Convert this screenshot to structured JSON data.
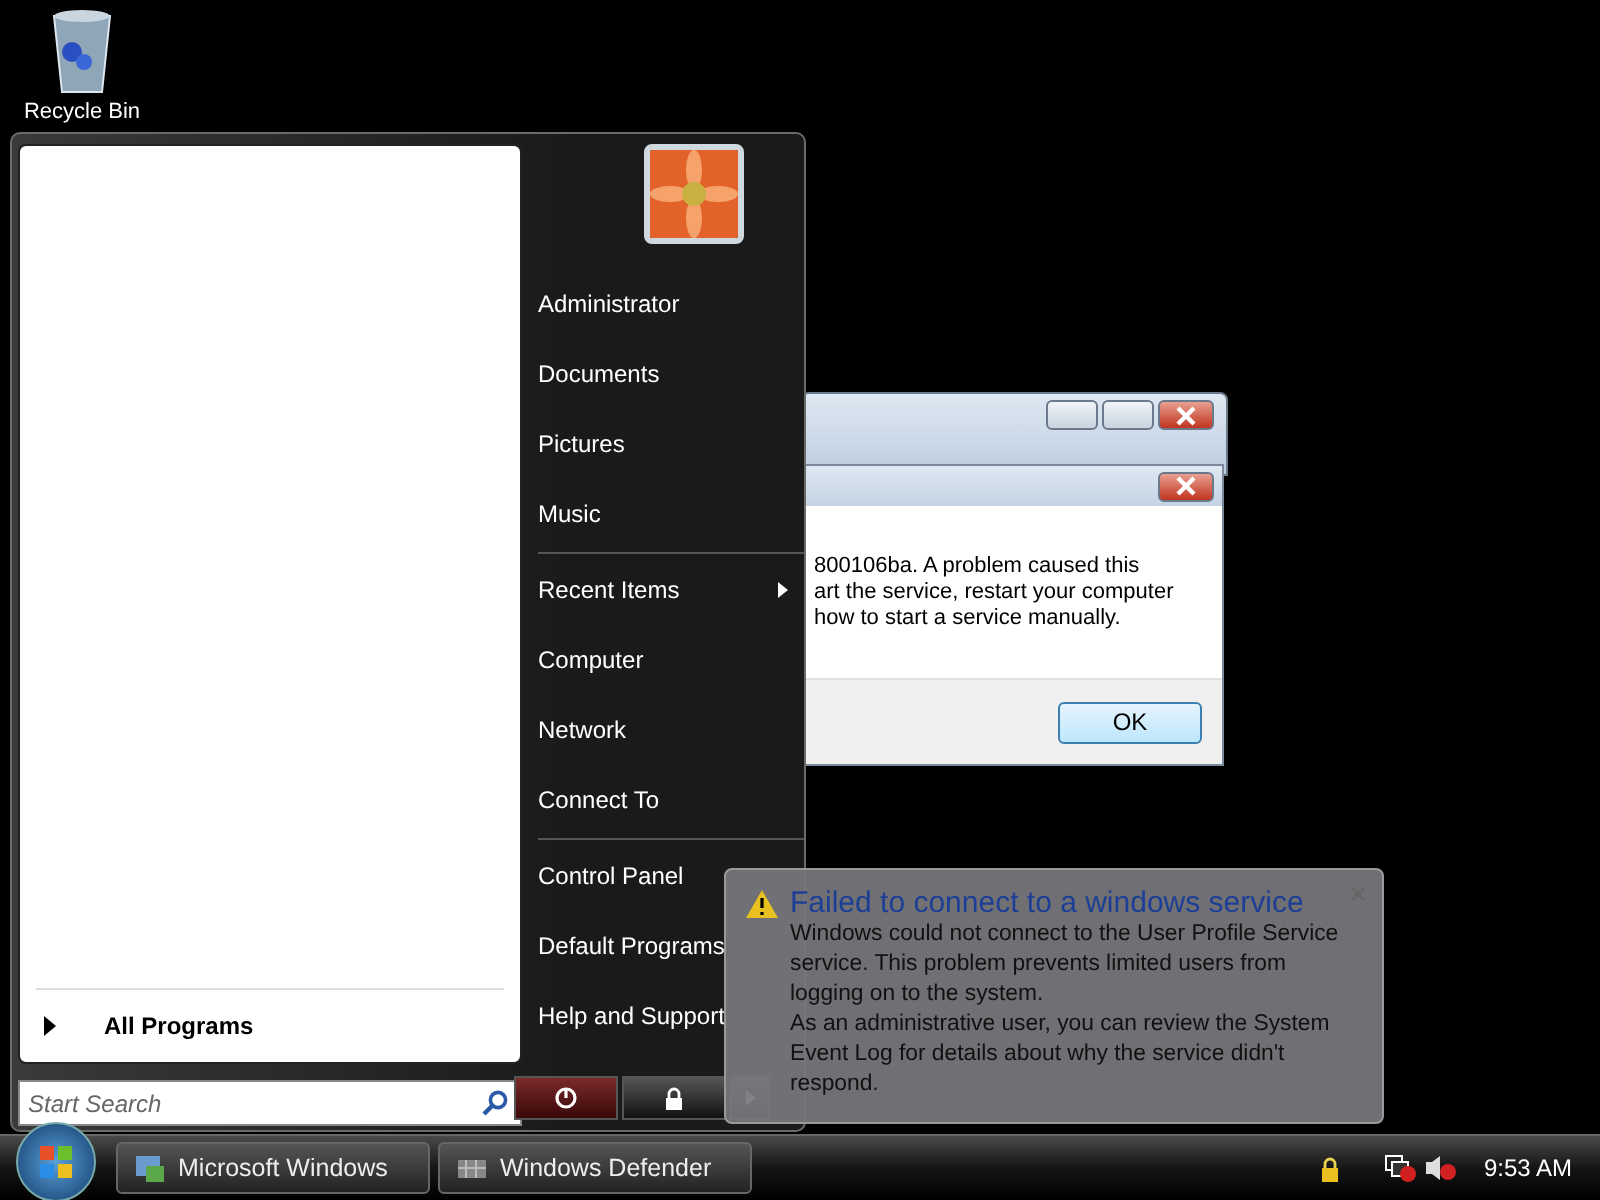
{
  "desktop_icons": [
    {
      "label": "Recycle Bin"
    }
  ],
  "dialog": {
    "message_lines": [
      "800106ba. A problem caused this",
      "art the service, restart your computer",
      "how to start a service manually."
    ],
    "ok_button": "OK"
  },
  "start_menu": {
    "all_programs": "All Programs",
    "search": {
      "placeholder": "Start Search"
    },
    "groups": [
      {
        "items": [
          {
            "label": "Administrator",
            "submenu": false
          },
          {
            "label": "Documents",
            "submenu": false
          },
          {
            "label": "Pictures",
            "submenu": false
          },
          {
            "label": "Music",
            "submenu": false
          }
        ]
      },
      {
        "items": [
          {
            "label": "Recent Items",
            "submenu": true
          },
          {
            "label": "Computer",
            "submenu": false
          },
          {
            "label": "Network",
            "submenu": false
          },
          {
            "label": "Connect To",
            "submenu": false
          }
        ]
      },
      {
        "items": [
          {
            "label": "Control Panel",
            "submenu": false
          },
          {
            "label": "Default Programs",
            "submenu": false
          },
          {
            "label": "Help and Support",
            "submenu": false
          }
        ]
      }
    ]
  },
  "notification": {
    "title": "Failed to connect to a windows service",
    "paragraphs": [
      "Windows could not connect to the User Profile Service service. This problem prevents limited users from logging on to the system.",
      "As an administrative user, you can review the System Event Log for details about why the service didn't respond."
    ]
  },
  "taskbar": {
    "buttons": [
      {
        "label": "Microsoft Windows"
      },
      {
        "label": "Windows Defender"
      }
    ],
    "clock": "9:53 AM"
  }
}
